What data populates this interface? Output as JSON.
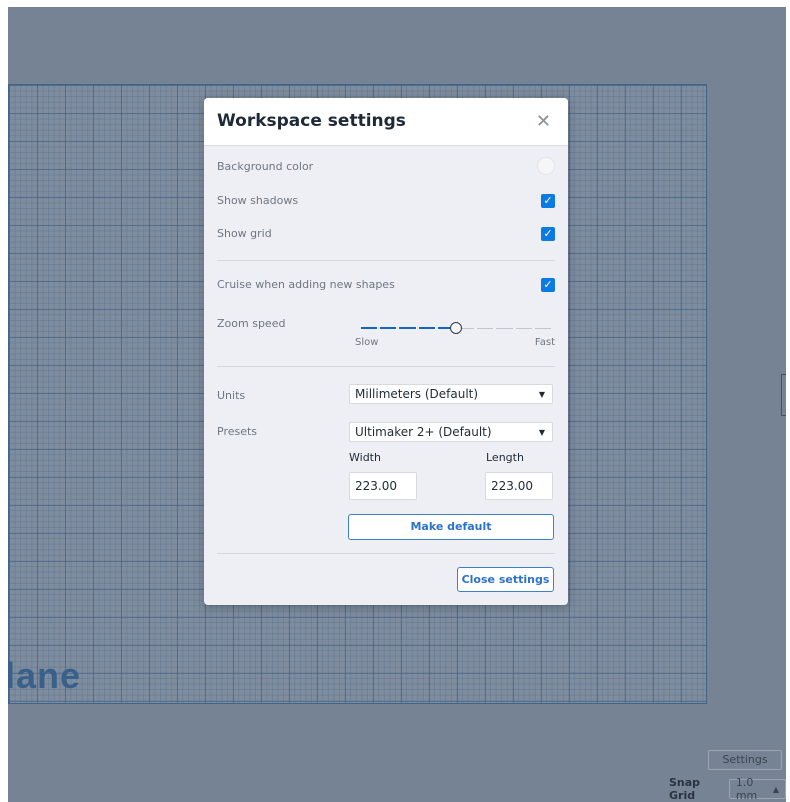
{
  "workplane": {
    "label": "lane"
  },
  "dialog": {
    "title": "Workspace settings",
    "close_icon": "close-icon",
    "background_color": {
      "label": "Background color",
      "swatch": "#f6f6f9"
    },
    "show_shadows": {
      "label": "Show shadows",
      "checked": true
    },
    "show_grid": {
      "label": "Show grid",
      "checked": true
    },
    "cruise": {
      "label": "Cruise when adding new shapes",
      "checked": true
    },
    "zoom_speed": {
      "label": "Zoom speed",
      "min_label": "Slow",
      "max_label": "Fast",
      "steps": 10,
      "value_step": 5
    },
    "units": {
      "label": "Units",
      "selected": "Millimeters (Default)"
    },
    "presets": {
      "label": "Presets",
      "selected": "Ultimaker 2+ (Default)"
    },
    "width": {
      "label": "Width",
      "value": "223.00"
    },
    "length": {
      "label": "Length",
      "value": "223.00"
    },
    "make_default_label": "Make default",
    "close_settings_label": "Close settings",
    "accent": "#0b7ae3"
  },
  "footer": {
    "settings_label": "Settings",
    "snap_grid_label": "Snap Grid",
    "snap_grid_value": "1.0 mm"
  }
}
